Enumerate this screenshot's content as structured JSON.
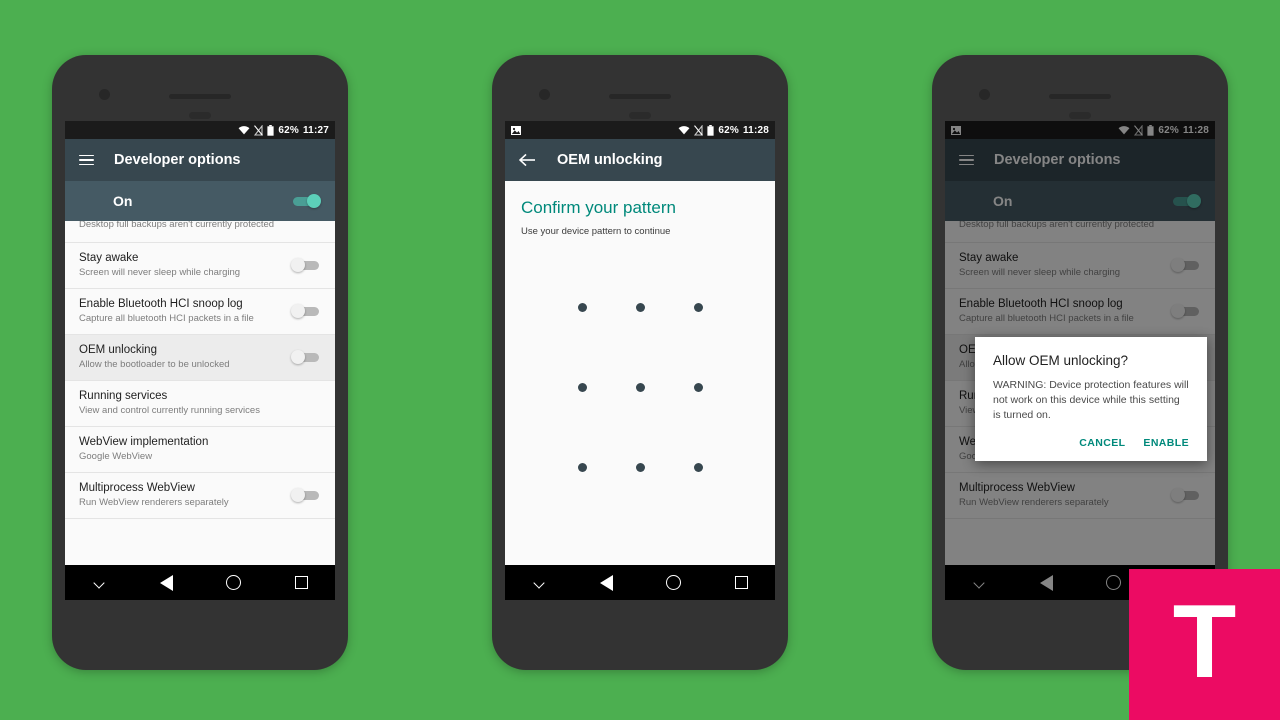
{
  "background_color": "#4caf50",
  "accent_teal": "#00897b",
  "toolbar_color": "#37474f",
  "phones": [
    {
      "id": "phone-1",
      "status_bar": {
        "battery_pct": "62%",
        "time": "11:27",
        "icons": [
          "wifi-icon",
          "no-sim-icon",
          "battery-icon"
        ]
      },
      "toolbar": {
        "menu_icon": "hamburger-icon",
        "title": "Developer options"
      },
      "master_switch": {
        "label": "On",
        "state": "on"
      },
      "list": [
        {
          "title": "",
          "subtitle": "Desktop full backups aren't currently protected",
          "clipped": true
        },
        {
          "title": "Stay awake",
          "subtitle": "Screen will never sleep while charging",
          "switch": "off"
        },
        {
          "title": "Enable Bluetooth HCI snoop log",
          "subtitle": "Capture all bluetooth HCI packets in a file",
          "switch": "off"
        },
        {
          "title": "OEM unlocking",
          "subtitle": "Allow the bootloader to be unlocked",
          "switch": "off",
          "highlighted": true
        },
        {
          "title": "Running services",
          "subtitle": "View and control currently running services"
        },
        {
          "title": "WebView implementation",
          "subtitle": "Google WebView"
        },
        {
          "title": "Multiprocess WebView",
          "subtitle": "Run WebView renderers separately",
          "switch": "off"
        }
      ],
      "nav": [
        "chevron-down-icon",
        "back-icon",
        "home-icon",
        "recents-icon"
      ]
    },
    {
      "id": "phone-2",
      "status_bar": {
        "battery_pct": "62%",
        "time": "11:28",
        "icons": [
          "screenshot-icon",
          "wifi-icon",
          "no-sim-icon",
          "battery-icon"
        ]
      },
      "toolbar": {
        "menu_icon": "back-arrow-icon",
        "title": "OEM unlocking"
      },
      "pattern": {
        "heading": "Confirm your pattern",
        "subtitle": "Use your device pattern to continue",
        "grid_rows": 3,
        "grid_cols": 3,
        "dot_color": "#37474f"
      },
      "nav": [
        "chevron-down-icon",
        "back-icon",
        "home-icon",
        "recents-icon"
      ]
    },
    {
      "id": "phone-3",
      "status_bar": {
        "battery_pct": "62%",
        "time": "11:28",
        "icons": [
          "screenshot-icon",
          "wifi-icon",
          "no-sim-icon",
          "battery-icon"
        ]
      },
      "toolbar": {
        "menu_icon": "hamburger-icon",
        "title": "Developer options"
      },
      "master_switch": {
        "label": "On",
        "state": "on"
      },
      "list": [
        {
          "title": "",
          "subtitle": "Desktop full backups aren't currently protected",
          "clipped": true
        },
        {
          "title": "Stay awake",
          "subtitle": "Screen will never sleep while charging",
          "switch": "off"
        },
        {
          "title": "Enable Bluetooth HCI snoop log",
          "subtitle": "Capture all bluetooth HCI packets in a file",
          "switch": "off"
        },
        {
          "title": "OEM unlocking",
          "subtitle": "Allow the bootloader to be unlocked",
          "switch": "off",
          "highlighted": true
        },
        {
          "title": "Running services",
          "subtitle": "View and control currently running services"
        },
        {
          "title": "WebView implementation",
          "subtitle": "Google WebView"
        },
        {
          "title": "Multiprocess WebView",
          "subtitle": "Run WebView renderers separately",
          "switch": "off"
        }
      ],
      "dialog": {
        "title": "Allow OEM unlocking?",
        "body": "WARNING: Device protection features will not work on this device while this setting is turned on.",
        "cancel_label": "CANCEL",
        "enable_label": "ENABLE"
      },
      "nav": [
        "chevron-down-icon",
        "back-icon",
        "home-icon",
        "recents-icon"
      ]
    }
  ],
  "watermark": {
    "letter": "T",
    "color": "#ec0b63"
  }
}
